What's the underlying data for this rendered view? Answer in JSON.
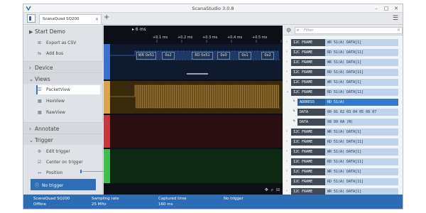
{
  "window": {
    "title": "ScanaStudio 3.0.8",
    "tab_label": "ScanaQuad SQ200",
    "colors": {
      "accent": "#2f6db5",
      "status_bar": "#2b6cb4",
      "wave_bg": "#0c0f15"
    }
  },
  "sidebar": {
    "start_demo": "Start Demo",
    "export_csv": "Export as CSV",
    "add_bus": "Add bus",
    "device": "Device",
    "views": "Views",
    "packet_view": "PacketView",
    "hex_view": "HexView",
    "raw_view": "RawView",
    "annotate": "Annotate",
    "trigger": "Trigger",
    "edit_trigger": "Edit trigger",
    "center_on_trigger": "Center on trigger",
    "position": "Position",
    "no_trigger": "No trigger"
  },
  "waveform": {
    "cursor_time": "6 ms",
    "time_labels": [
      "+0.1 ms",
      "+0.2 ms",
      "+0.3 ms",
      "+0.4 ms",
      "+0.5 ms"
    ],
    "decoded": [
      "WR 0x51",
      "0x2",
      "RD 0x51",
      "0x0",
      "0x1",
      "0x2"
    ],
    "channel_colors": [
      "#3d6fd1",
      "#d9a44a",
      "#c8373d",
      "#3fbf4d"
    ],
    "progress": 0.02
  },
  "packets": {
    "filter_placeholder": "Filter",
    "frames": [
      {
        "tag": "I2C FRAME",
        "value": "WR 51(A) DATA[1]"
      },
      {
        "tag": "I2C FRAME",
        "value": "RD 51(A) DATA[11]"
      },
      {
        "tag": "I2C FRAME",
        "value": "WR 51(A) DATA[1]"
      },
      {
        "tag": "I2C FRAME",
        "value": "RD 51(A) DATA[11]"
      },
      {
        "tag": "I2C FRAME",
        "value": "WR 51(A) DATA[1]"
      },
      {
        "tag": "I2C FRAME",
        "value": "RD 51(A) DATA[11]"
      },
      {
        "tag": "ADDRESS",
        "value": "RD 51(A)"
      },
      {
        "tag": "DATA",
        "value": "00 01 02 03 04 05 06 07"
      },
      {
        "tag": "DATA",
        "value": "08 09 0A (N)"
      },
      {
        "tag": "I2C FRAME",
        "value": "WR 51(A) DATA[1]"
      },
      {
        "tag": "I2C FRAME",
        "value": "RD 51(A) DATA[11]"
      },
      {
        "tag": "I2C FRAME",
        "value": "WR 51(A) DATA[1]"
      },
      {
        "tag": "I2C FRAME",
        "value": "RD 51(A) DATA[11]"
      },
      {
        "tag": "I2C FRAME",
        "value": "WR 51(A) DATA[1]"
      },
      {
        "tag": "I2C FRAME",
        "value": "RD 51(A) DATA[11]"
      },
      {
        "tag": "I2C FRAME",
        "value": "WR 51(A) DATA[1]"
      }
    ]
  },
  "status": {
    "device_name": "ScanaQuad SQ200",
    "device_state": "Offline",
    "sampling_label": "Sampling rate",
    "sampling_value": "25 MHz",
    "captured_label": "Captured time",
    "captured_value": "160 ms",
    "trigger_label": "No trigger"
  }
}
